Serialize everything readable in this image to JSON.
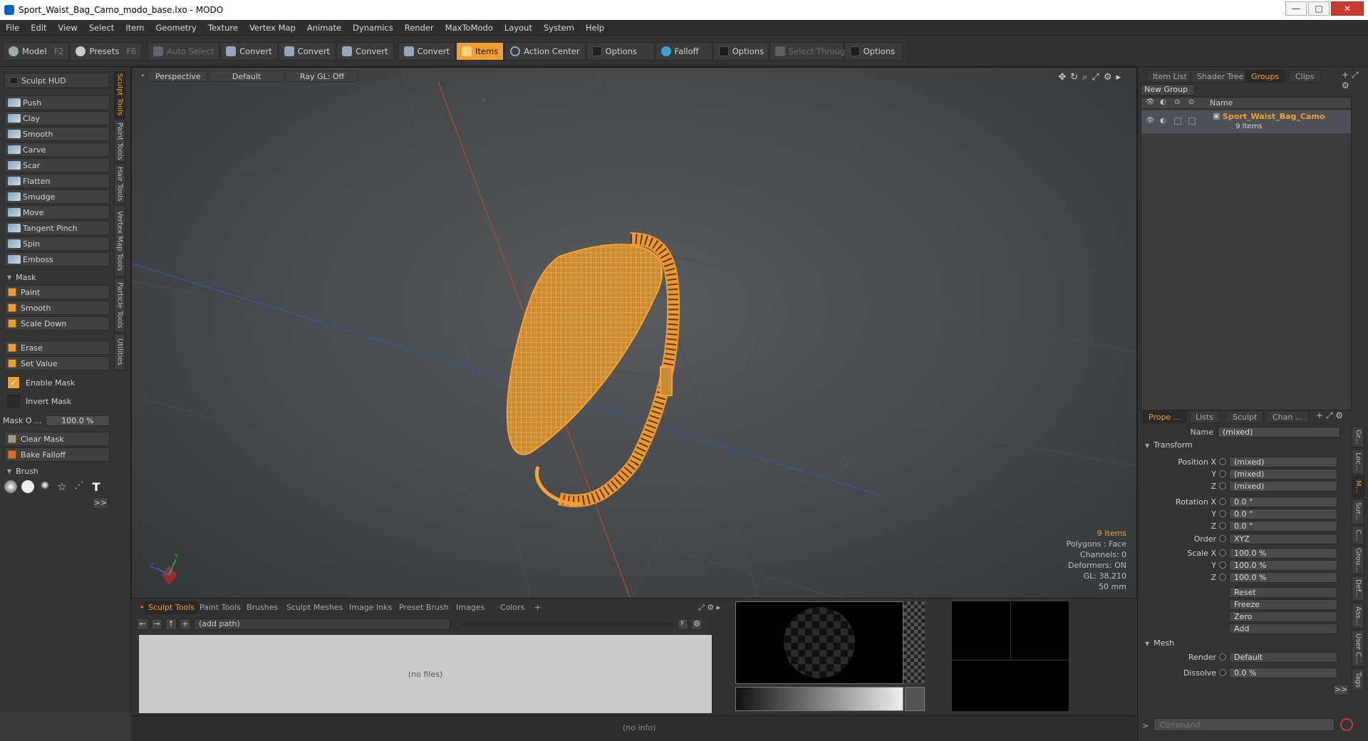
{
  "title": "Sport_Waist_Bag_Camo_modo_base.lxo - MODO",
  "window_buttons": [
    "—",
    "□",
    "✕"
  ],
  "menu": [
    "File",
    "Edit",
    "View",
    "Select",
    "Item",
    "Geometry",
    "Texture",
    "Vertex Map",
    "Animate",
    "Dynamics",
    "Render",
    "MaxToModo",
    "Layout",
    "System",
    "Help"
  ],
  "toolbar": {
    "model": "Model",
    "model_key": "F2",
    "presets": "Presets",
    "presets_key": "F6",
    "auto_select": "Auto Select",
    "convert": "Convert",
    "items": "Items",
    "action_center": "Action Center",
    "options": "Options",
    "falloff": "Falloff",
    "select_through": "Select Through"
  },
  "left": {
    "sculpt_hud": "Sculpt HUD",
    "tools": [
      "Push",
      "Clay",
      "Smooth",
      "Carve",
      "Scar",
      "Flatten",
      "Smudge",
      "Move",
      "Tangent Pinch",
      "Spin",
      "Emboss"
    ],
    "mask_section": "Mask",
    "mask_tools": [
      "Paint",
      "Smooth",
      "Scale Down"
    ],
    "erase": "Erase",
    "set_value": "Set Value",
    "enable_mask": "Enable Mask",
    "invert_mask": "Invert Mask",
    "mask_opacity_label": "Mask O ...",
    "mask_opacity_value": "100.0 %",
    "clear_mask": "Clear Mask",
    "bake_falloff": "Bake Falloff",
    "brush_section": "Brush",
    "more": ">>",
    "vtabs": [
      "Sculpt Tools",
      "Paint Tools",
      "Hair Tools",
      "Vertex Map Tools",
      "Particle Tools",
      "Utilities"
    ]
  },
  "viewport": {
    "view": "Perspective",
    "shading": "Default",
    "raygl": "Ray GL: Off",
    "info": {
      "items": "9 Items",
      "polygons": "Polygons : Face",
      "channels": "Channels: 0",
      "deformers": "Deformers: ON",
      "gl": "GL: 38,210",
      "unit": "50 mm"
    }
  },
  "bottom": {
    "tabs": [
      "Sculpt Tools",
      "Paint Tools",
      "Brushes",
      "Sculpt Meshes",
      "Image Inks",
      "Preset Brush",
      "Images",
      "Colors",
      "+"
    ],
    "path": "(add path)",
    "no_files": "(no files)",
    "status": "(no info)"
  },
  "right": {
    "top_tabs": [
      "Item List",
      "Shader Tree",
      "Groups",
      "Clips"
    ],
    "new_group": "New Group",
    "col_name": "Name",
    "group_name": "Sport_Waist_Bag_Camo",
    "group_count": "9 Items",
    "prop_tabs": [
      "Prope ...",
      "Lists",
      "Sculpt",
      "Chan ..."
    ],
    "name_label": "Name",
    "name_value": "(mixed)",
    "transform": "Transform",
    "position_x_label": "Position X",
    "rotation_x_label": "Rotation X",
    "scale_x_label": "Scale X",
    "y_label": "Y",
    "z_label": "Z",
    "position": [
      "(mixed)",
      "(mixed)",
      "(mixed)"
    ],
    "rotation": [
      "0.0 °",
      "0.0 °",
      "0.0 °"
    ],
    "order_label": "Order",
    "order_value": "XYZ",
    "scale": [
      "100.0 %",
      "100.0 %",
      "100.0 %"
    ],
    "buttons": [
      "Reset",
      "Freeze",
      "Zero",
      "Add"
    ],
    "mesh": "Mesh",
    "render_label": "Render",
    "render_value": "Default",
    "dissolve_label": "Dissolve",
    "dissolve_value": "0.0 %",
    "more": ">>",
    "side_tabs": [
      "Gr...",
      "Loc...",
      "M...",
      "Sur...",
      "C...",
      "Grou...",
      "Def...",
      "Ass...",
      "User C...",
      "Tags"
    ],
    "command_placeholder": "Command"
  }
}
